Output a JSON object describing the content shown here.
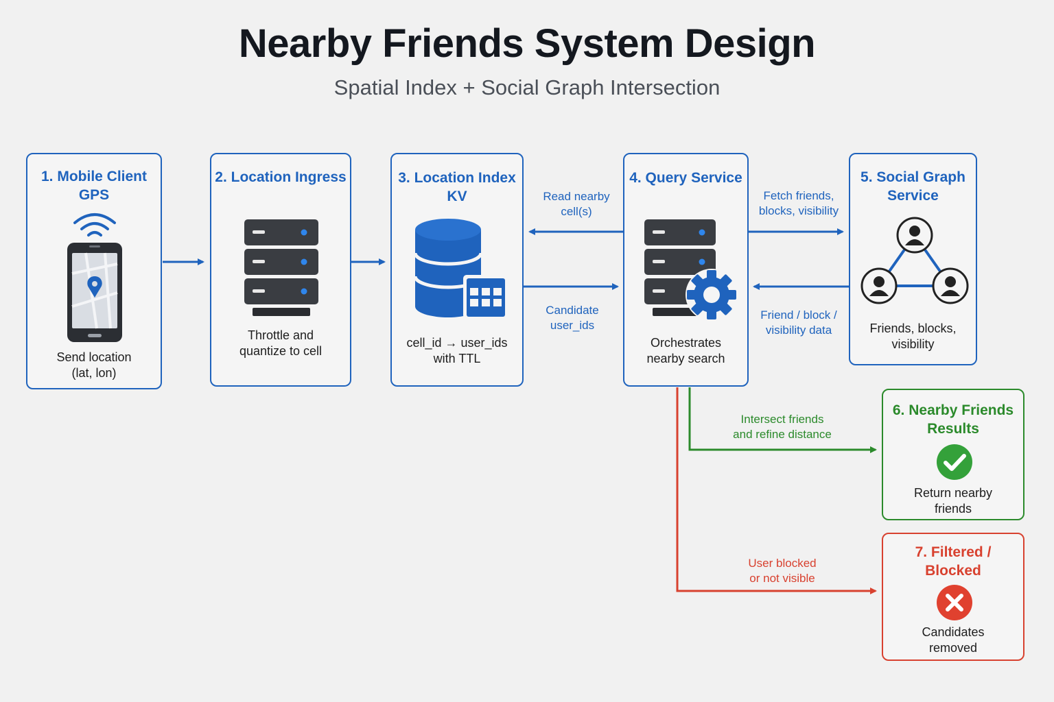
{
  "header": {
    "title": "Nearby Friends System Design",
    "subtitle": "Spatial Index + Social Graph Intersection"
  },
  "nodes": [
    {
      "title_line1": "1. Mobile Client",
      "title_line2": "GPS",
      "text_line1": "Send location",
      "text_line2": "(lat, lon)"
    },
    {
      "title_line1": "2. Location Ingress",
      "text_line1": "Throttle and",
      "text_line2": "quantize to cell"
    },
    {
      "title_line1": "3. Location Index KV",
      "text_line1": "cell_id → user_ids",
      "text_line2": "with TTL"
    },
    {
      "title_line1": "4. Query Service",
      "text_line1": "Orchestrates",
      "text_line2": "nearby search"
    },
    {
      "title_line1": "5. Social Graph",
      "title_line2": "Service",
      "text_line1": "Friends, blocks,",
      "text_line2": "visibility"
    },
    {
      "title_line1": "6. Nearby Friends",
      "title_line2": "Results",
      "text_line1": "Return nearby",
      "text_line2": "friends"
    },
    {
      "title_line1": "7. Filtered /",
      "title_line2": "Blocked",
      "text_line1": "Candidates",
      "text_line2": "removed"
    }
  ],
  "edges": {
    "read_nearby": {
      "line1": "Read nearby",
      "line2": "cell(s)"
    },
    "candidate": {
      "line1": "Candidate",
      "line2": "user_ids"
    },
    "fetch_friends": {
      "line1": "Fetch friends,",
      "line2": "blocks, visibility"
    },
    "friend_data": {
      "line1": "Friend / block /",
      "line2": "visibility data"
    },
    "intersect": {
      "line1": "Intersect friends",
      "line2": "and refine distance"
    },
    "blocked": {
      "line1": "User blocked",
      "line2": "or not visible"
    }
  },
  "colors": {
    "blue": "#1f63bd",
    "green": "#2b8a2b",
    "red": "#d8412f",
    "server": "#3a3d42"
  },
  "icons": [
    "phone-gps-icon",
    "server-icon",
    "database-table-icon",
    "server-gear-icon",
    "social-graph-icon",
    "check-circle-icon",
    "x-circle-icon"
  ]
}
